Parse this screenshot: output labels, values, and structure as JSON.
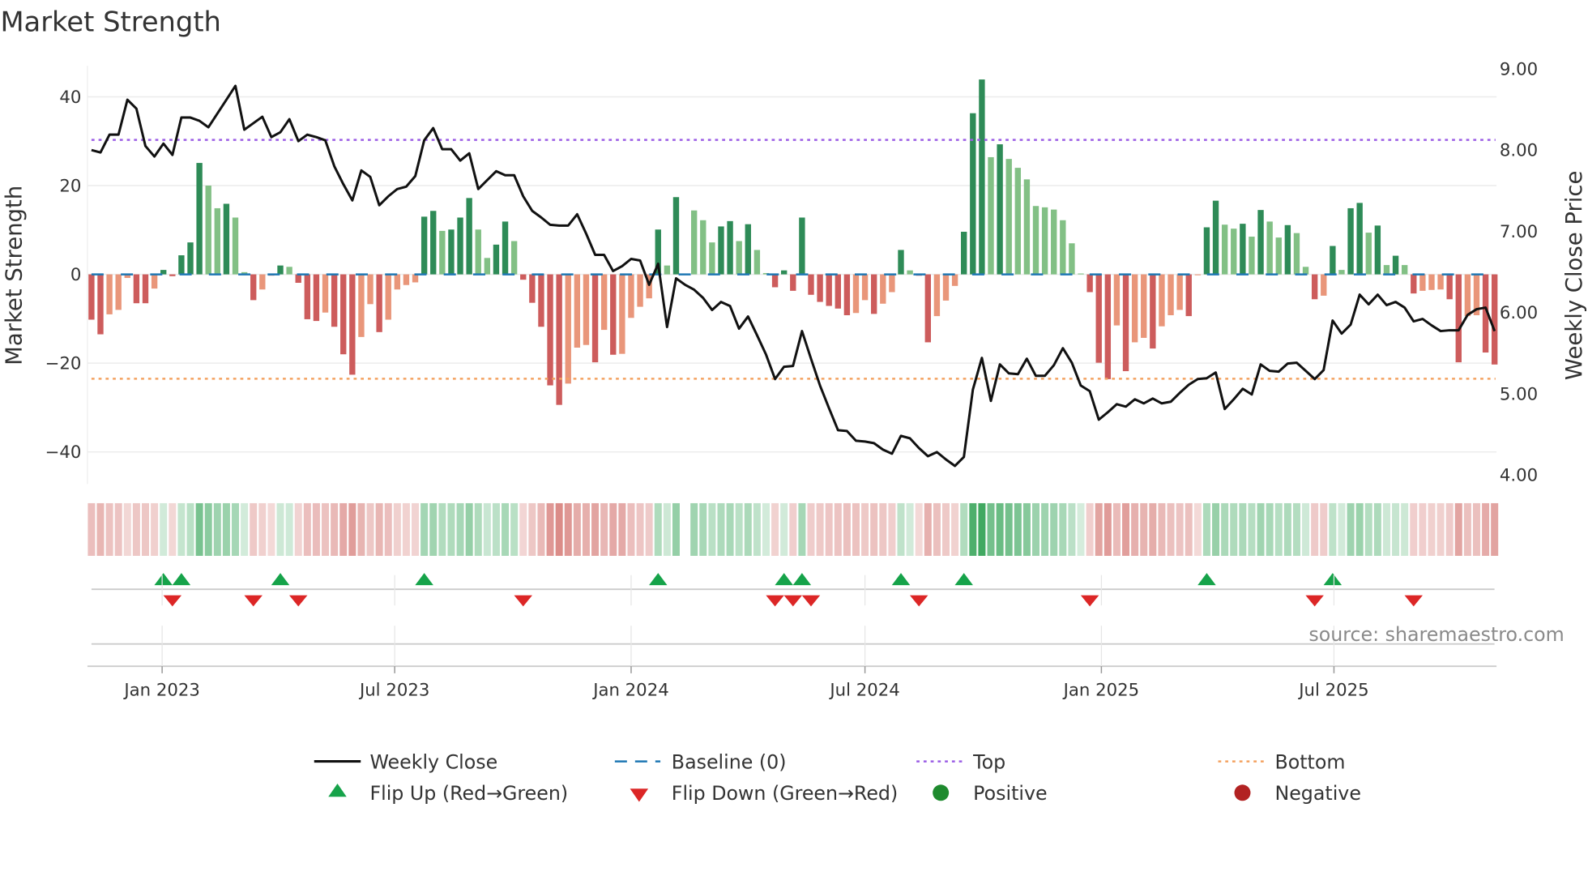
{
  "title": "Market Strength",
  "source_note": "source: sharemaestro.com",
  "chart_data": {
    "type": "bar",
    "title": "Market Strength",
    "ylabel": "Market Strength",
    "y2label": "Weekly Close Price",
    "ylim": [
      -47,
      47
    ],
    "y2lim": [
      3.85,
      9.15
    ],
    "yticks": [
      "40",
      "20",
      "0",
      "−40"
    ],
    "ytick_values": [
      40,
      20,
      0,
      -20,
      -40
    ],
    "ytick_labels": [
      "40",
      "20",
      "0",
      "−20",
      "−40"
    ],
    "y2tick_values": [
      9,
      8,
      7,
      6,
      5,
      4
    ],
    "y2tick_labels": [
      "9.00",
      "8.00",
      "7.00",
      "6.00",
      "5.00",
      "4.00"
    ],
    "xtick_dates": [
      "2023-01-01",
      "2023-07-01",
      "2024-01-01",
      "2024-07-01",
      "2025-01-01",
      "2025-07-01"
    ],
    "xtick_labels": [
      "Jan 2023",
      "Jul 2023",
      "Jan 2024",
      "Jul 2024",
      "Jan 2025",
      "Jul 2025"
    ],
    "x_start": "2022-11-07",
    "x_step_days": 7,
    "top": 30.3,
    "bottom": -23.5,
    "baseline": 0,
    "grid": true,
    "strength": [
      -10.2,
      -13.5,
      -9.0,
      -8.0,
      -0.8,
      -6.5,
      -6.5,
      -3.2,
      1.0,
      -0.4,
      4.3,
      7.2,
      25.1,
      20.0,
      14.9,
      15.9,
      12.8,
      0.5,
      -5.8,
      -3.4,
      -0.3,
      2.0,
      1.7,
      -1.9,
      -10.1,
      -10.5,
      -8.6,
      -11.8,
      -18.0,
      -22.6,
      -14.1,
      -6.7,
      -13.0,
      -10.2,
      -3.4,
      -2.4,
      -1.8,
      13.0,
      14.3,
      9.8,
      10.1,
      12.8,
      17.2,
      10.1,
      3.7,
      6.7,
      11.9,
      7.5,
      -1.2,
      -6.4,
      -11.8,
      -25.0,
      -29.4,
      -24.6,
      -16.5,
      -15.9,
      -19.8,
      -12.5,
      -18.1,
      -17.9,
      -9.8,
      -7.3,
      -5.4,
      10.1,
      2.0,
      17.4,
      0,
      14.4,
      12.2,
      7.2,
      10.8,
      12.0,
      7.5,
      11.3,
      5.5,
      0.3,
      -2.9,
      0.9,
      -3.7,
      12.8,
      -4.6,
      -6.2,
      -7.1,
      -7.7,
      -9.2,
      -8.7,
      -5.8,
      -8.9,
      -6.6,
      -4.0,
      5.5,
      0.9,
      -0.3,
      -15.3,
      -9.4,
      -5.9,
      -2.6,
      9.6,
      36.3,
      43.9,
      26.4,
      29.3,
      26.0,
      24.0,
      21.4,
      15.4,
      15.1,
      14.6,
      12.2,
      7.0,
      0.2,
      -4.0,
      -19.9,
      -23.6,
      -11.5,
      -21.8,
      -15.3,
      -14.3,
      -16.7,
      -11.7,
      -9.2,
      -8.0,
      -9.4,
      -0.2,
      10.6,
      16.6,
      11.2,
      10.3,
      11.4,
      8.5,
      14.5,
      11.9,
      8.3,
      11.1,
      9.3,
      1.7,
      -5.6,
      -4.8,
      6.4,
      1.0,
      14.9,
      16.1,
      9.4,
      11.0,
      2.1,
      4.2,
      2.1,
      -4.3,
      -3.7,
      -3.5,
      -3.4,
      -5.6,
      -19.8,
      -9.4,
      -9.2,
      -17.6,
      -20.3
    ],
    "weekly_close": [
      8.0,
      7.97,
      8.19,
      8.19,
      8.62,
      8.51,
      8.05,
      7.92,
      8.08,
      7.94,
      8.4,
      8.4,
      8.36,
      8.28,
      8.45,
      8.62,
      8.79,
      8.25,
      8.33,
      8.41,
      8.16,
      8.22,
      8.38,
      8.11,
      8.19,
      8.16,
      8.12,
      7.8,
      7.58,
      7.38,
      7.75,
      7.67,
      7.32,
      7.43,
      7.52,
      7.55,
      7.68,
      8.12,
      8.27,
      8.01,
      8.01,
      7.87,
      7.96,
      7.52,
      7.63,
      7.74,
      7.69,
      7.69,
      7.43,
      7.25,
      7.17,
      7.08,
      7.07,
      7.07,
      7.21,
      6.97,
      6.71,
      6.71,
      6.51,
      6.57,
      6.66,
      6.64,
      6.34,
      6.6,
      5.82,
      6.42,
      6.34,
      6.28,
      6.18,
      6.03,
      6.13,
      6.08,
      5.8,
      5.95,
      5.72,
      5.48,
      5.18,
      5.33,
      5.34,
      5.77,
      5.43,
      5.1,
      4.82,
      4.55,
      4.54,
      4.42,
      4.41,
      4.39,
      4.31,
      4.26,
      4.48,
      4.45,
      4.33,
      4.23,
      4.28,
      4.19,
      4.11,
      4.22,
      5.05,
      5.44,
      4.91,
      5.36,
      5.25,
      5.24,
      5.43,
      5.22,
      5.22,
      5.35,
      5.56,
      5.38,
      5.1,
      5.03,
      4.68,
      4.77,
      4.87,
      4.84,
      4.93,
      4.88,
      4.94,
      4.88,
      4.9,
      5.01,
      5.11,
      5.18,
      5.19,
      5.26,
      4.81,
      4.93,
      5.06,
      4.99,
      5.36,
      5.28,
      5.27,
      5.37,
      5.38,
      5.28,
      5.18,
      5.29,
      5.9,
      5.74,
      5.85,
      6.22,
      6.1,
      6.22,
      6.09,
      6.13,
      6.06,
      5.89,
      5.92,
      5.84,
      5.77,
      5.78,
      5.78,
      5.97,
      6.04,
      6.06,
      5.77
    ],
    "flip_up": [
      "2023-01-02",
      "2023-01-16",
      "2023-04-03",
      "2023-07-24",
      "2024-01-22",
      "2024-04-29",
      "2024-05-13",
      "2024-07-29",
      "2024-09-16",
      "2025-03-24",
      "2025-06-30"
    ],
    "flip_down": [
      "2023-01-09",
      "2023-03-13",
      "2023-04-17",
      "2023-10-09",
      "2024-04-22",
      "2024-05-06",
      "2024-05-20",
      "2024-08-12",
      "2024-12-23",
      "2025-06-16",
      "2025-09-01"
    ],
    "legend": {
      "placement": "bottom",
      "items": [
        {
          "label": "Weekly Close",
          "kind": "line"
        },
        {
          "label": "Baseline (0)",
          "kind": "dash"
        },
        {
          "label": "Top",
          "kind": "dot-purple"
        },
        {
          "label": "Bottom",
          "kind": "dot-orange"
        },
        {
          "label": "Flip Up (Red→Green)",
          "kind": "triangle-up"
        },
        {
          "label": "Flip Down (Green→Red)",
          "kind": "triangle-down"
        },
        {
          "label": "Positive",
          "kind": "circle-green"
        },
        {
          "label": "Negative",
          "kind": "circle-red"
        }
      ]
    },
    "colors": {
      "pos_strong": "#2e8b57",
      "pos_weak": "#82c085",
      "neg_strong": "#cd5c5c",
      "neg_weak": "#e9967a",
      "close": "#111111",
      "baseline": "#1f77b4",
      "top": "#9b5de5",
      "bottom": "#f4a261",
      "flip_up": "#16a34a",
      "flip_down": "#dc2626",
      "positive": "#1e8a2e",
      "negative": "#b22222",
      "grid": "#ececec",
      "axis": "#cccccc"
    }
  }
}
